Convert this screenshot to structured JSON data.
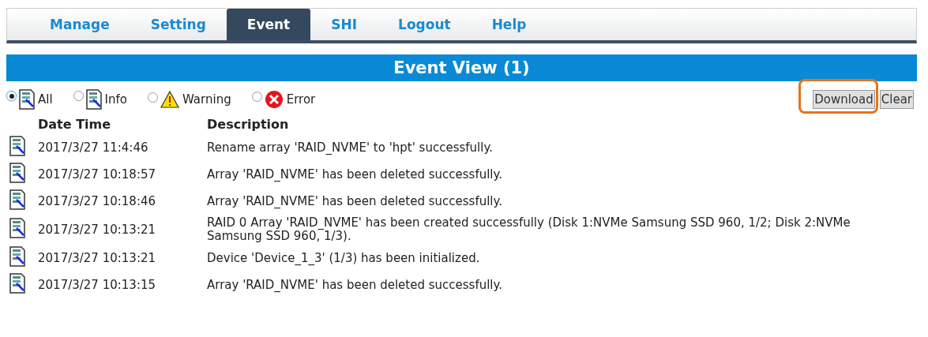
{
  "tabs": [
    {
      "label": "Manage",
      "selected": false
    },
    {
      "label": "Setting",
      "selected": false
    },
    {
      "label": "Event",
      "selected": true
    },
    {
      "label": "SHI",
      "selected": false
    },
    {
      "label": "Logout",
      "selected": false
    },
    {
      "label": "Help",
      "selected": false
    }
  ],
  "title": "Event View (1)",
  "filters": [
    {
      "label": "All",
      "kind": "info",
      "selected": true
    },
    {
      "label": "Info",
      "kind": "info",
      "selected": false
    },
    {
      "label": "Warning",
      "kind": "warning",
      "selected": false
    },
    {
      "label": "Error",
      "kind": "error",
      "selected": false
    }
  ],
  "buttons": [
    {
      "label": "Download",
      "highlighted": true
    },
    {
      "label": "Clear",
      "highlighted": false
    }
  ],
  "table": {
    "columns": [
      "Date Time",
      "Description"
    ],
    "rows": [
      {
        "kind": "info",
        "date_time": "2017/3/27 11:4:46",
        "description": "Rename array 'RAID_NVME' to 'hpt' successfully."
      },
      {
        "kind": "info",
        "date_time": "2017/3/27 10:18:57",
        "description": "Array 'RAID_NVME' has been deleted successfully."
      },
      {
        "kind": "info",
        "date_time": "2017/3/27 10:18:46",
        "description": "Array 'RAID_NVME' has been deleted successfully."
      },
      {
        "kind": "info",
        "date_time": "2017/3/27 10:13:21",
        "description": "RAID 0 Array 'RAID_NVME' has been created successfully (Disk 1:NVMe Samsung SSD 960, 1/2; Disk 2:NVMe Samsung SSD 960, 1/3)."
      },
      {
        "kind": "info",
        "date_time": "2017/3/27 10:13:21",
        "description": "Device 'Device_1_3' (1/3) has been initialized."
      },
      {
        "kind": "info",
        "date_time": "2017/3/27 10:13:15",
        "description": "Array 'RAID_NVME' has been deleted successfully."
      }
    ]
  }
}
